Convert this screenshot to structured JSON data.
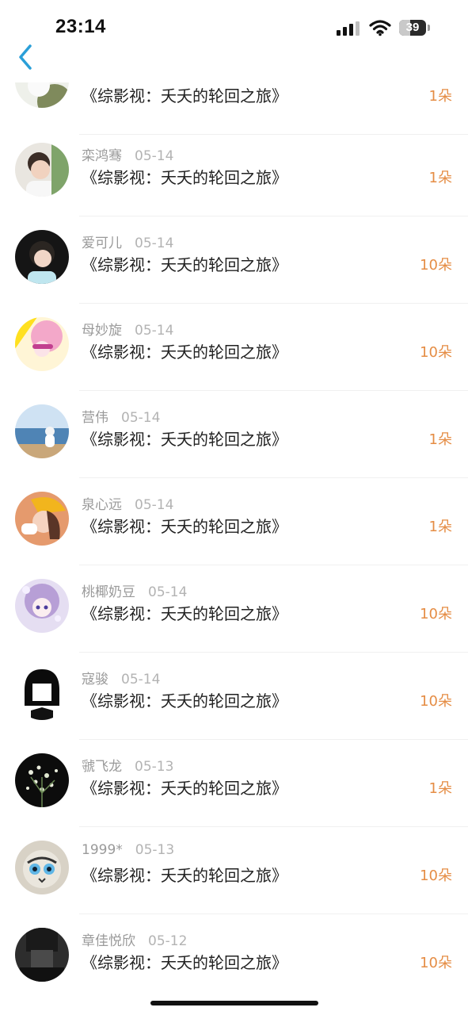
{
  "status_bar": {
    "time": "23:14",
    "battery": "39"
  },
  "colors": {
    "accent": "#2a9fd8",
    "gift": "#e58d45",
    "name": "#9a9a9a"
  },
  "list": {
    "rows": [
      {
        "name": "",
        "date": "",
        "book": "《综影视：夭夭的轮回之旅》",
        "gift": "1朵",
        "avatar": "partial"
      },
      {
        "name": "栾鸿骞",
        "date": "05-14",
        "book": "《综影视：夭夭的轮回之旅》",
        "gift": "1朵",
        "avatar": "man"
      },
      {
        "name": "爱可儿",
        "date": "05-14",
        "book": "《综影视：夭夭的轮回之旅》",
        "gift": "10朵",
        "avatar": "girl-dark"
      },
      {
        "name": "母妙旋",
        "date": "05-14",
        "book": "《综影视：夭夭的轮回之旅》",
        "gift": "10朵",
        "avatar": "pink-anime"
      },
      {
        "name": "营伟",
        "date": "05-14",
        "book": "《综影视：夭夭的轮回之旅》",
        "gift": "1朵",
        "avatar": "sea"
      },
      {
        "name": "泉心远",
        "date": "05-14",
        "book": "《综影视：夭夭的轮回之旅》",
        "gift": "1朵",
        "avatar": "girl-hat"
      },
      {
        "name": "桃椰奶豆",
        "date": "05-14",
        "book": "《综影视：夭夭的轮回之旅》",
        "gift": "10朵",
        "avatar": "purple-anime"
      },
      {
        "name": "寇骏",
        "date": "05-14",
        "book": "《综影视：夭夭的轮回之旅》",
        "gift": "10朵",
        "avatar": "bw-girl"
      },
      {
        "name": "虢飞龙",
        "date": "05-13",
        "book": "《综影视：夭夭的轮回之旅》",
        "gift": "1朵",
        "avatar": "flowers"
      },
      {
        "name": "1999*",
        "date": "05-13",
        "book": "《综影视：夭夭的轮回之旅》",
        "gift": "10朵",
        "avatar": "cat"
      },
      {
        "name": "章佳悦欣",
        "date": "05-12",
        "book": "《综影视：夭夭的轮回之旅》",
        "gift": "10朵",
        "avatar": "dark-person"
      }
    ]
  }
}
